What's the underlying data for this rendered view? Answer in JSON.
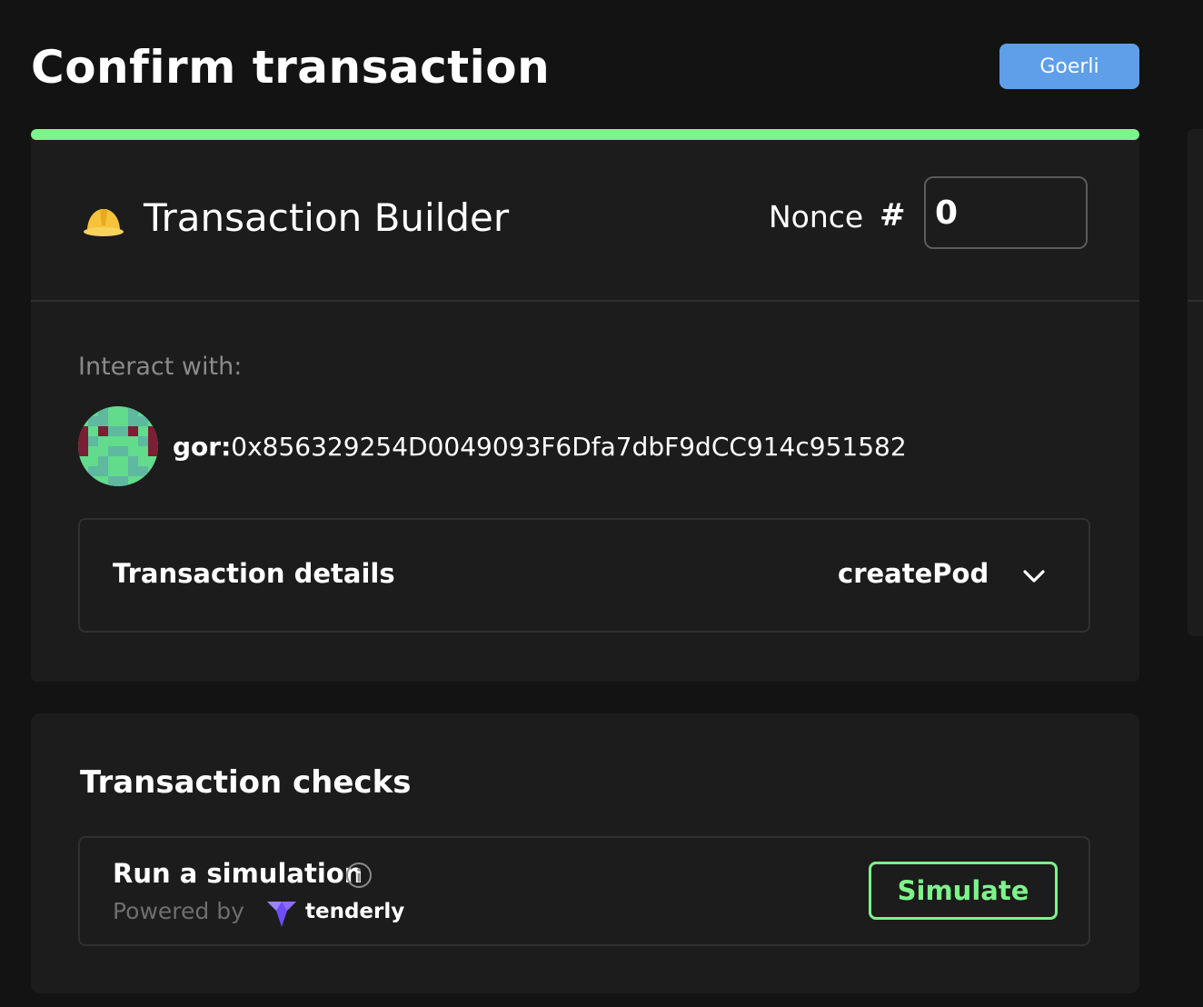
{
  "page": {
    "title": "Confirm transaction"
  },
  "network": {
    "label": "Goerli",
    "color": "#5f9ee8"
  },
  "progress": {
    "percent": 100,
    "color": "#7df38b"
  },
  "builder": {
    "app_name": "Transaction Builder",
    "app_icon": "hard-hat-icon",
    "nonce_label": "Nonce",
    "nonce_hash": "#",
    "nonce_value": "0",
    "interact_label": "Interact with:",
    "address_prefix": "gor:",
    "address": "0x856329254D0049093F6Dfa7dbF9dCC914c951582",
    "details_label": "Transaction details",
    "method": "createPod"
  },
  "checks": {
    "title": "Transaction checks",
    "simulation_label": "Run a simulation",
    "powered_by": "Powered by",
    "provider": "tenderly",
    "simulate_button": "Simulate",
    "accent": "#7df38b"
  }
}
